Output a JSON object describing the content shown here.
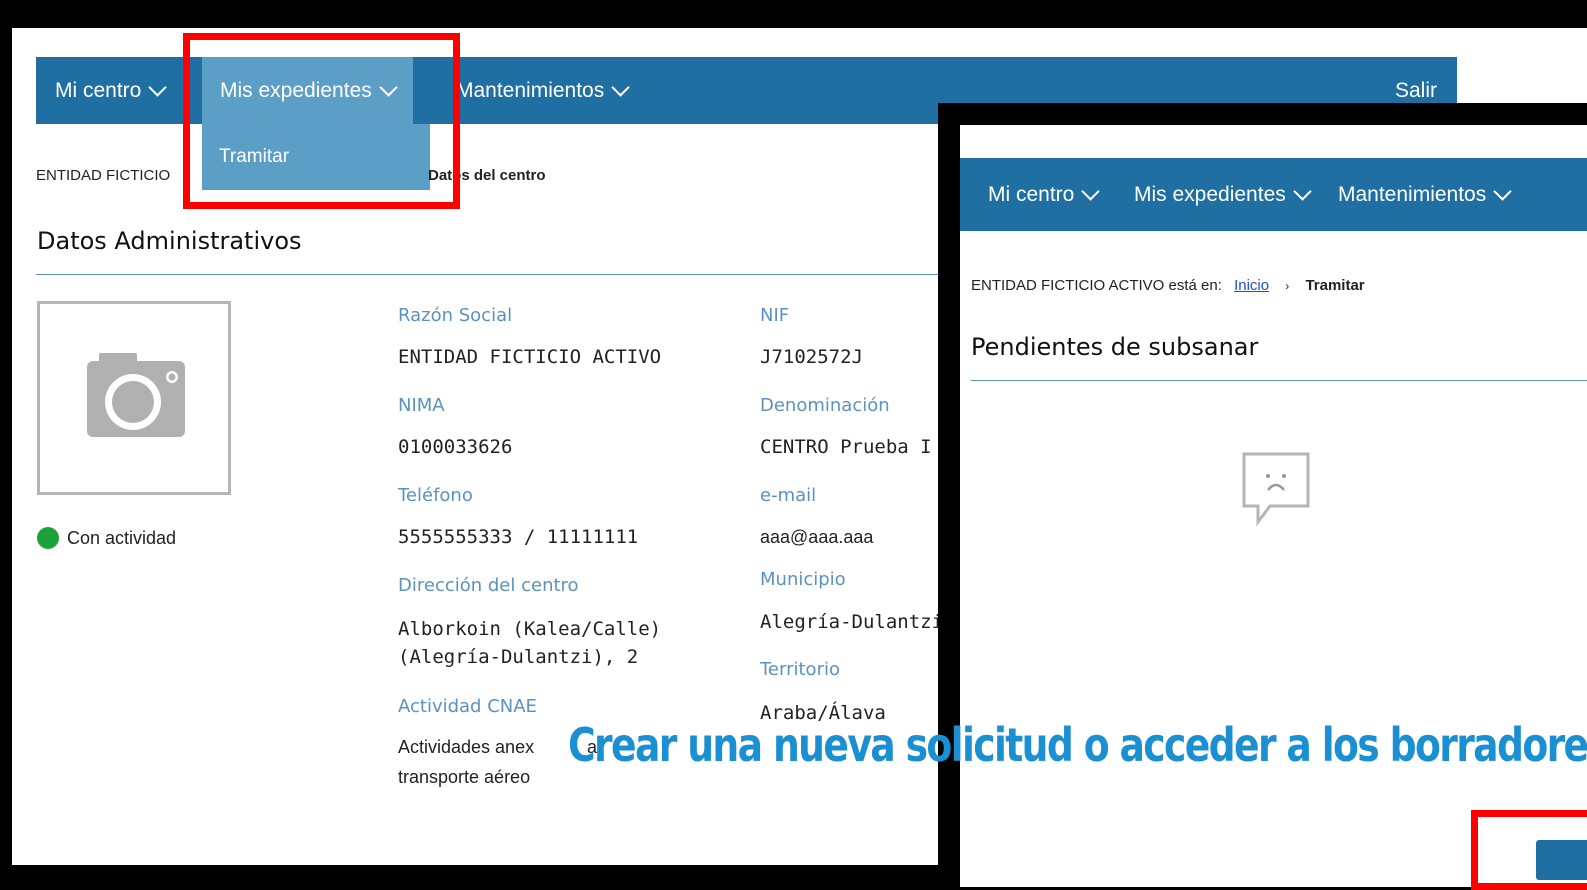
{
  "left": {
    "nav": {
      "items": [
        {
          "label": "Mi centro"
        },
        {
          "label": "Mis expedientes"
        },
        {
          "label": "Mantenimientos"
        }
      ],
      "logout": "Salir",
      "dropdown_item": "Tramitar"
    },
    "breadcrumb": {
      "prefix": "ENTIDAD FICTICIO",
      "current": "Datos del centro"
    },
    "title": "Datos Administrativos",
    "status": "Con actividad",
    "fields": {
      "razon_social_label": "Razón Social",
      "razon_social": "ENTIDAD FICTICIO ACTIVO",
      "nif_label": "NIF",
      "nif": "J7102572J",
      "nima_label": "NIMA",
      "nima": "0100033626",
      "denominacion_label": "Denominación",
      "denominacion": "CENTRO Prueba I",
      "telefono_label": "Teléfono",
      "telefono": "5555555333 / 11111111",
      "email_label": "e-mail",
      "email": "aaa@aaa.aaa",
      "direccion_label": "Dirección del centro",
      "direccion_1": "Alborkoin (Kalea/Calle)",
      "direccion_2": "(Alegría-Dulantzi), 2",
      "municipio_label": "Municipio",
      "municipio": "Alegría-Dulantzi",
      "territorio_label": "Territorio",
      "territorio": "Araba/Álava",
      "actividad_label": "Actividad CNAE",
      "actividad_1": "Actividades anex",
      "actividad_1_tail": "al",
      "actividad_2": "transporte aéreo"
    }
  },
  "right": {
    "nav": {
      "items": [
        {
          "label": "Mi centro"
        },
        {
          "label": "Mis expedientes"
        },
        {
          "label": "Mantenimientos"
        }
      ]
    },
    "breadcrumb": {
      "prefix": "ENTIDAD FICTICIO ACTIVO está en:",
      "home": "Inicio",
      "current": "Tramitar"
    },
    "title": "Pendientes de subsanar"
  },
  "caption": "Crear una nueva solicitud o acceder a los borradores",
  "colors": {
    "nav": "#1f6fa3",
    "accent": "#5b92bf",
    "highlight": "#ff0000",
    "caption": "#1a8fd2",
    "status_dot": "#1aa33a"
  }
}
